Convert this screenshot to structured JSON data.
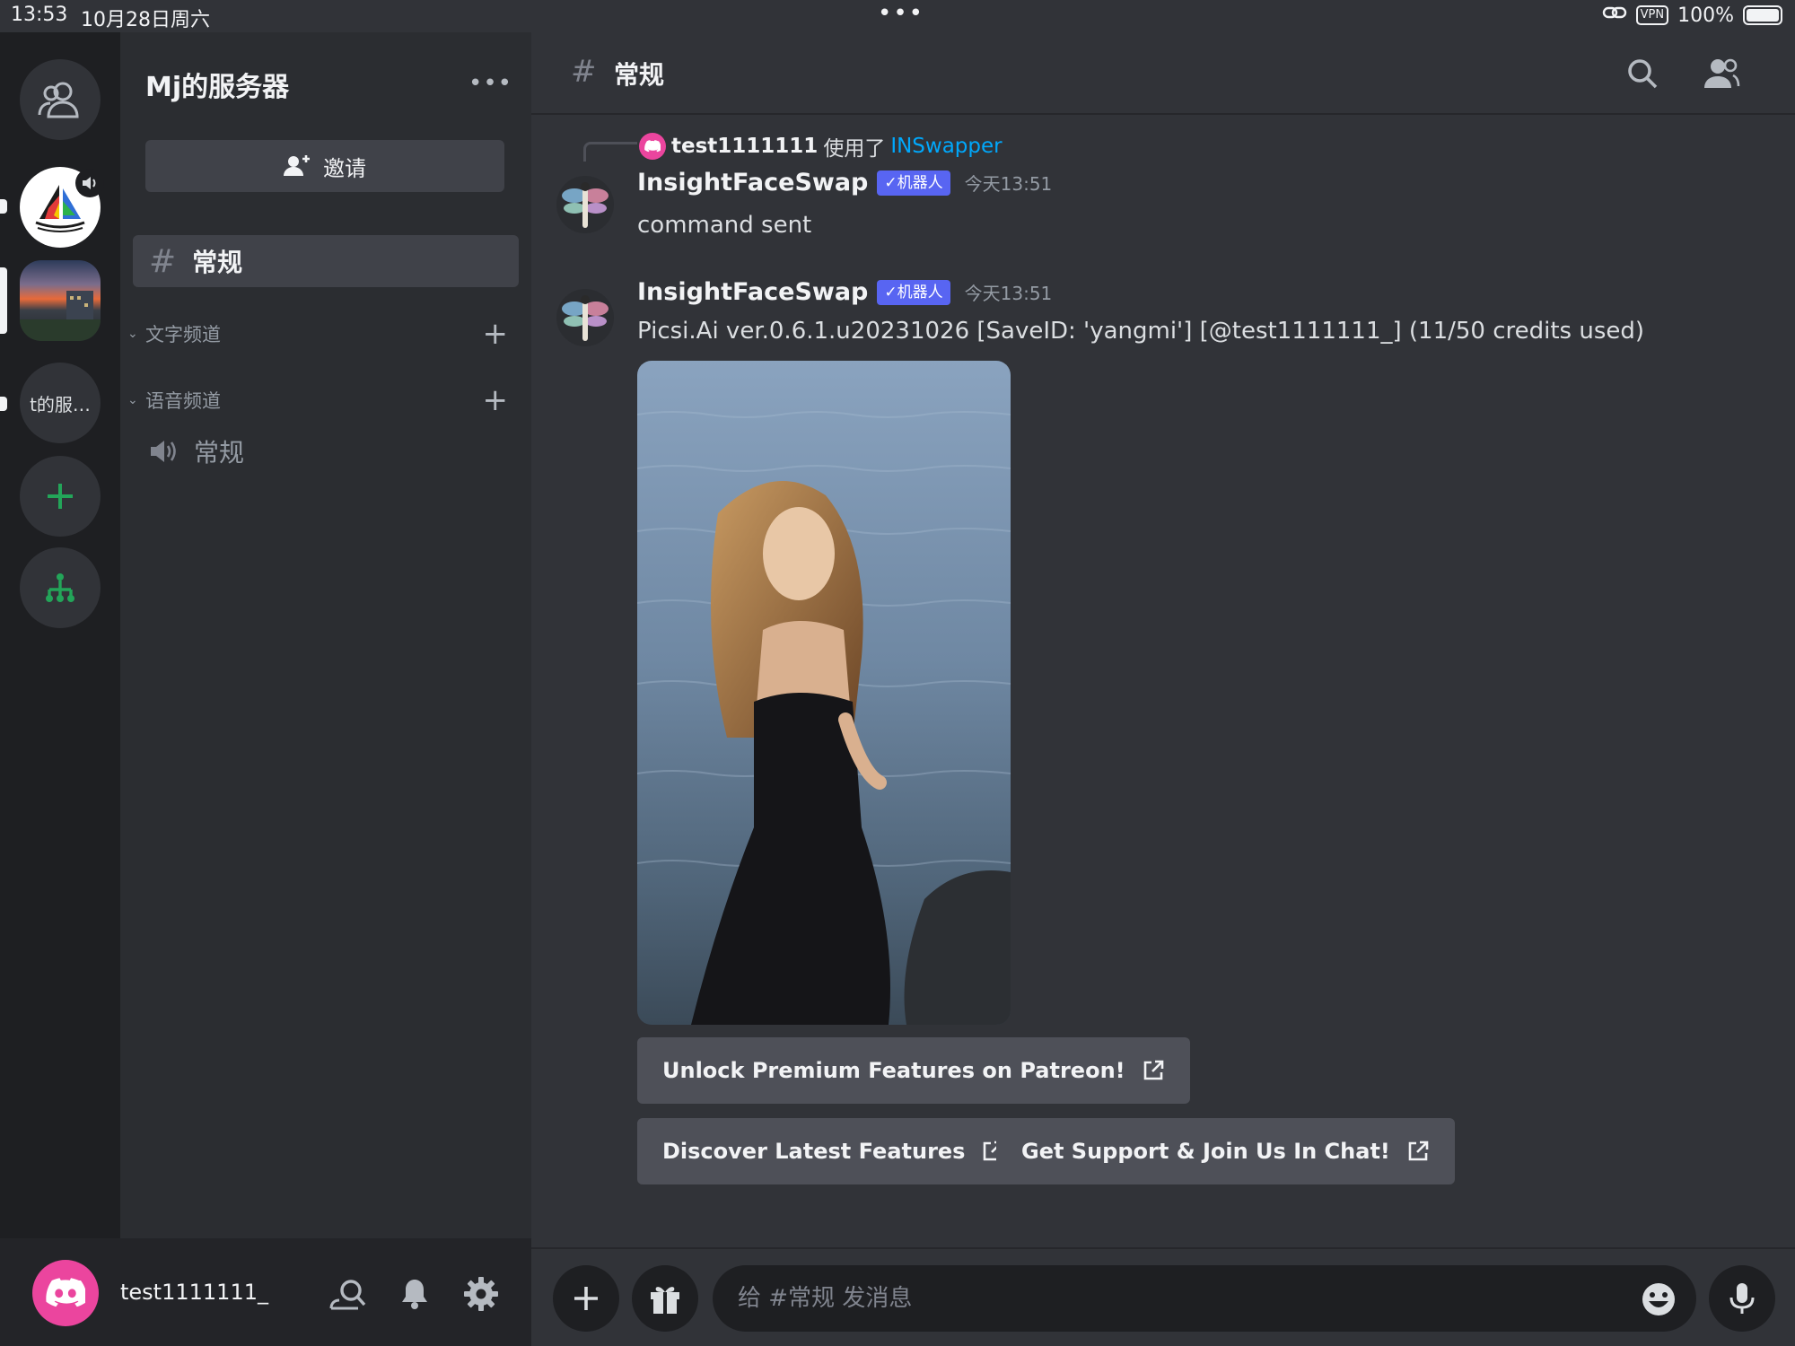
{
  "status_bar": {
    "time": "13:53",
    "date": "10月28日周六",
    "dots": "•••",
    "vpn": "VPN",
    "battery": "100%"
  },
  "servers": {
    "text_server_label": "t的服…"
  },
  "guild": {
    "name": "Mj的服务器",
    "more": "•••",
    "invite_label": "邀请"
  },
  "channels": {
    "active_text_channel": "常规",
    "text_category": "文字频道",
    "voice_category": "语音频道",
    "voice_channel": "常规"
  },
  "user": {
    "name": "test1111111_"
  },
  "header": {
    "channel_name": "常规"
  },
  "messages": [
    {
      "reply": {
        "user": "test1111111",
        "verb": "使用了",
        "command": "INSwapper"
      },
      "author": "InsightFaceSwap",
      "bot_tag": "✓机器人",
      "timestamp": "今天13:51",
      "text": "command sent"
    },
    {
      "author": "InsightFaceSwap",
      "bot_tag": "✓机器人",
      "timestamp": "今天13:51",
      "text": "Picsi.Ai ver.0.6.1.u20231026 [SaveID: 'yangmi'] [@test1111111_] (11/50 credits used)",
      "buttons": [
        "Unlock Premium Features on Patreon!",
        "Discover Latest Features",
        "Get Support & Join Us In Chat!"
      ]
    }
  ],
  "composer": {
    "placeholder": "给 #常规 发消息"
  },
  "colors": {
    "accent": "#5865f2",
    "link": "#00a8fc",
    "avatar_pink": "#eb459e",
    "green": "#23a559"
  }
}
